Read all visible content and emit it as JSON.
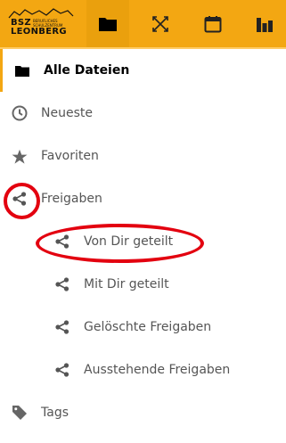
{
  "brand": {
    "name_line1": "BSZ",
    "name_line2": "LEONBERG",
    "tagline_line1": "BERUFLICHES",
    "tagline_line2": "SCHULZENTRUM"
  },
  "header": {
    "apps": [
      {
        "icon": "folder-icon",
        "active": true
      },
      {
        "icon": "transfer-icon",
        "active": false
      },
      {
        "icon": "calendar-icon",
        "active": false
      },
      {
        "icon": "dashboard-icon",
        "active": false
      }
    ]
  },
  "nav": {
    "items": [
      {
        "label": "Alle Dateien",
        "icon": "folder-icon",
        "active": true
      },
      {
        "label": "Neueste",
        "icon": "clock-icon"
      },
      {
        "label": "Favoriten",
        "icon": "star-icon"
      },
      {
        "label": "Freigaben",
        "icon": "share-icon"
      },
      {
        "label": "Von Dir geteilt",
        "icon": "share-icon",
        "sub": true
      },
      {
        "label": "Mit Dir geteilt",
        "icon": "share-icon",
        "sub": true
      },
      {
        "label": "Gelöschte Freigaben",
        "icon": "share-icon",
        "sub": true
      },
      {
        "label": "Ausstehende Freigaben",
        "icon": "share-icon",
        "sub": true
      },
      {
        "label": "Tags",
        "icon": "tag-icon"
      }
    ]
  },
  "colors": {
    "header_bg": "#f3a712",
    "highlight_ring": "#e3000f"
  }
}
